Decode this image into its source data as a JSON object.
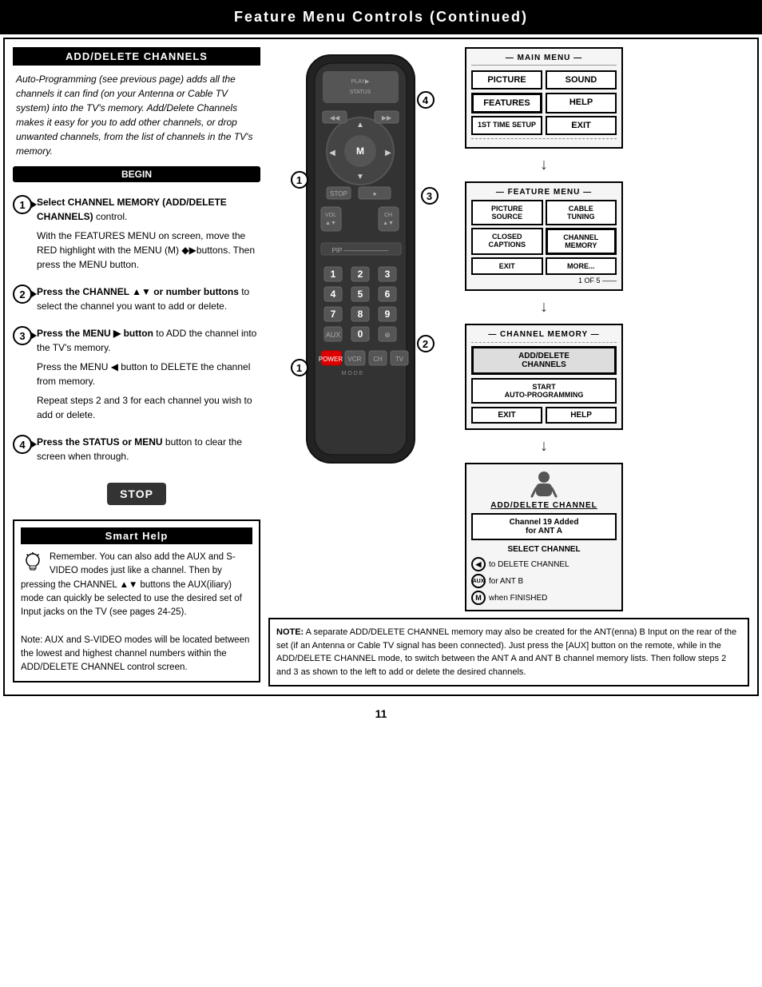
{
  "header": {
    "title": "Feature Menu Controls (Continued)"
  },
  "left_panel": {
    "section_title": "ADD/DELETE CHANNELS",
    "intro_text": "Auto-Programming (see previous page) adds all the channels it can find (on your Antenna or Cable TV system) into the TV's memory. Add/Delete Channels makes it easy for you to add other channels, or drop unwanted channels, from the list of channels in the TV's memory.",
    "begin_label": "BEGIN",
    "steps": [
      {
        "number": "1",
        "bold_text": "Select CHANNEL MEMORY (ADD/DELETE CHANNELS)",
        "text": " control.\n\nWith the FEATURES MENU on screen, move the RED highlight with the MENU (M) ◆▶buttons. Then press the MENU button."
      },
      {
        "number": "2",
        "bold_text": "Press the CHANNEL ▲▼ or number buttons",
        "text": " to select the channel you want to add or delete."
      },
      {
        "number": "3",
        "bold_text": "Press the MENU ▶ button",
        "text": " to ADD the channel into the TV's memory.\n\nPress the MENU ◀ button to DELETE the channel from memory.\n\nRepeat steps 2 and 3 for each channel you wish to add or delete."
      },
      {
        "number": "4",
        "bold_text": "Press the STATUS or MENU",
        "text": " button to clear the screen when through."
      }
    ],
    "stop_label": "STOP",
    "smart_help": {
      "title": "Smart Help",
      "text": "Remember. You can also add the AUX and S-VIDEO modes just like a channel. Then by pressing the CHANNEL ▲▼ buttons the AUX(iliary) mode can quickly be selected to use the desired set of Input jacks on the TV (see pages 24-25).\n\nNote: AUX and S-VIDEO modes will be located between the lowest and highest channel numbers within the ADD/DELETE CHANNEL control screen."
    }
  },
  "menus": {
    "main_menu": {
      "title": "MAIN MENU",
      "buttons": [
        "PICTURE",
        "SOUND",
        "FEATURES",
        "HELP",
        "1ST TIME SETUP",
        "EXIT"
      ]
    },
    "feature_menu": {
      "title": "FEATURE MENU",
      "buttons": [
        "PICTURE SOURCE",
        "CABLE TUNING",
        "CLOSED CAPTIONS",
        "CHANNEL MEMORY",
        "EXIT",
        "MORE..."
      ],
      "of_label": "1 OF 5"
    },
    "channel_memory": {
      "title": "CHANNEL MEMORY",
      "buttons": [
        "ADD/DELETE CHANNELS",
        "START AUTO-PROGRAMMING"
      ],
      "exit": "EXIT",
      "help": "HELP"
    },
    "add_delete": {
      "title": "ADD/DELETE CHANNEL",
      "channel_added": "Channel 19 Added\nfor ANT A",
      "select_channel": "SELECT CHANNEL",
      "options": [
        {
          "icon": "◀",
          "text": "to DELETE CHANNEL"
        },
        {
          "icon": "AUX",
          "text": "for ANT B"
        },
        {
          "icon": "M",
          "text": "when FINISHED"
        }
      ]
    }
  },
  "note": {
    "text": "NOTE: A separate ADD/DELETE CHANNEL memory may also be created for the ANT(enna) B Input on the rear of the set (if an Antenna or Cable TV signal has been connected). Just press the [AUX] button on the remote, while in the ADD/DELETE CHANNEL mode, to switch between the ANT A and ANT B channel memory lists. Then follow steps 2 and 3 as shown to the left to add or delete the desired channels."
  },
  "page_number": "11"
}
